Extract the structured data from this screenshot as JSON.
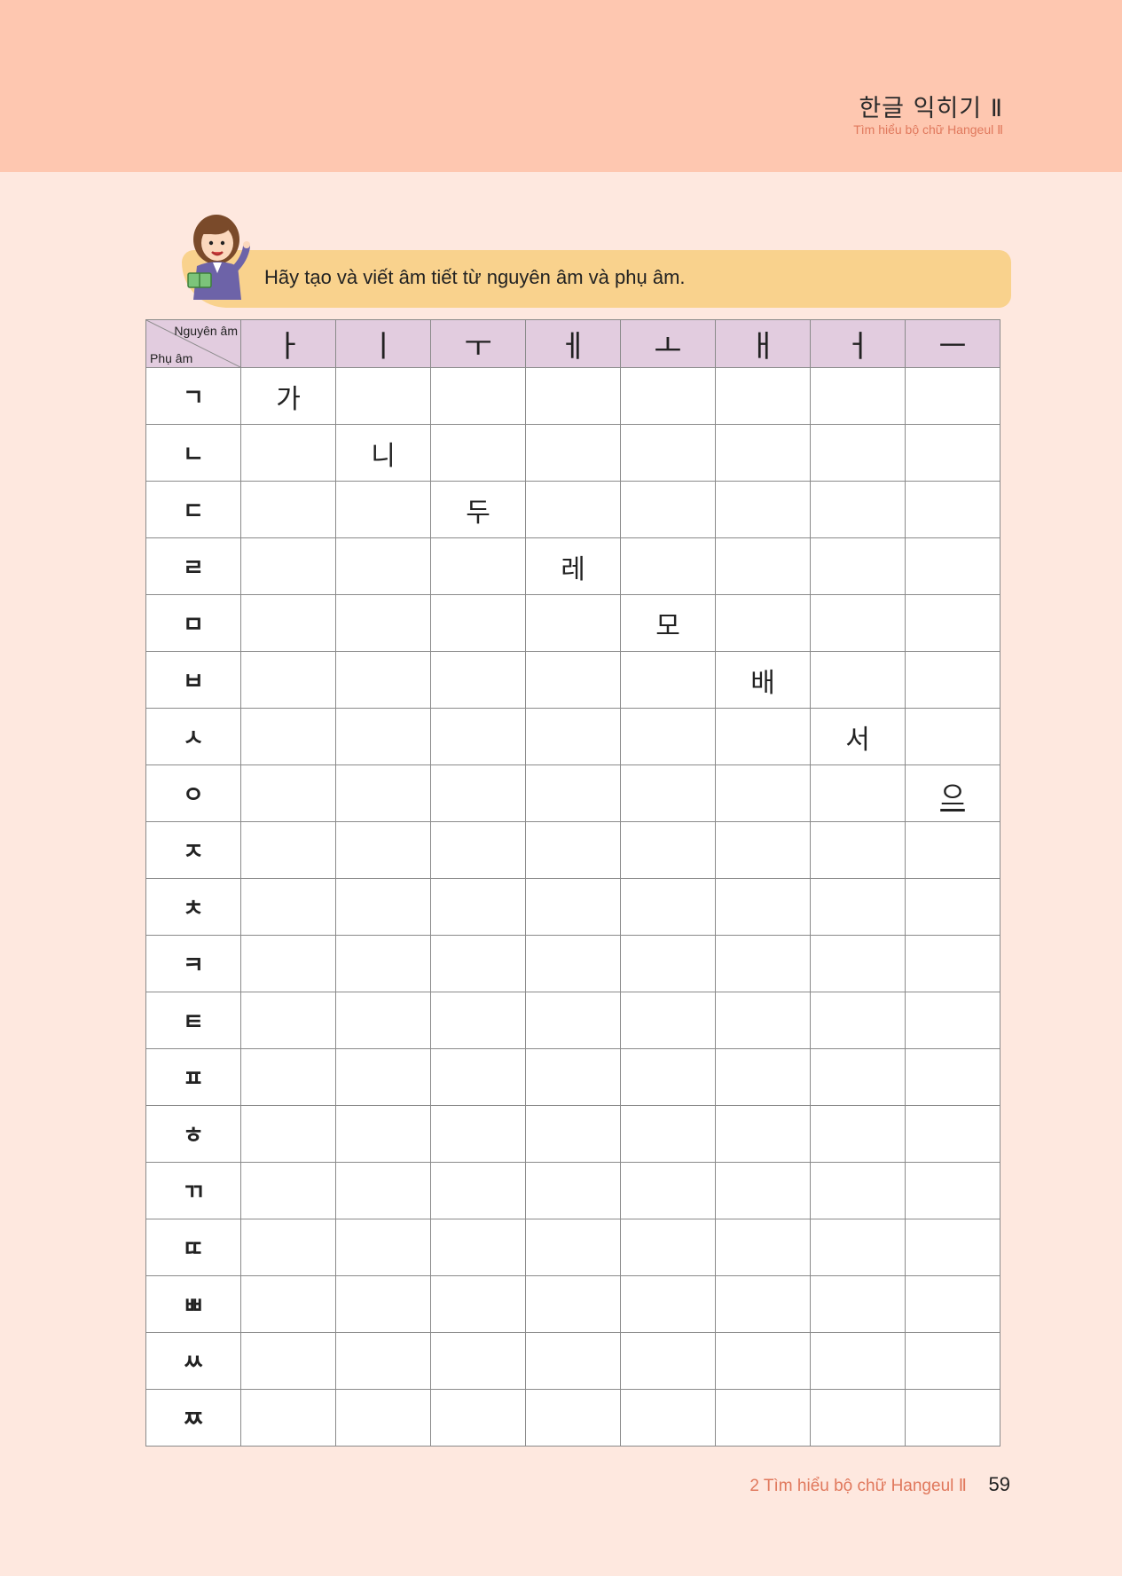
{
  "header": {
    "title": "한글 익히기 Ⅱ",
    "subtitle": "Tìm hiểu bộ chữ Hangeul Ⅱ"
  },
  "instruction": "Hãy tạo và viết âm tiết từ nguyên âm và phụ âm.",
  "table": {
    "corner_top": "Nguyên âm",
    "corner_bottom": "Phụ âm",
    "vowels": [
      "ㅏ",
      "ㅣ",
      "ㅜ",
      "ㅔ",
      "ㅗ",
      "ㅐ",
      "ㅓ",
      "ㅡ"
    ],
    "consonants": [
      "ㄱ",
      "ㄴ",
      "ㄷ",
      "ㄹ",
      "ㅁ",
      "ㅂ",
      "ㅅ",
      "ㅇ",
      "ㅈ",
      "ㅊ",
      "ㅋ",
      "ㅌ",
      "ㅍ",
      "ㅎ",
      "ㄲ",
      "ㄸ",
      "ㅃ",
      "ㅆ",
      "ㅉ"
    ],
    "examples": [
      "가",
      "니",
      "두",
      "레",
      "모",
      "배",
      "서",
      "으"
    ],
    "highlight_color": "#c6202a"
  },
  "footer": {
    "label": "2 Tìm hiểu bộ chữ Hangeul Ⅱ",
    "page_number": "59"
  },
  "icons": {
    "teacher": "teacher-illustration-icon"
  }
}
